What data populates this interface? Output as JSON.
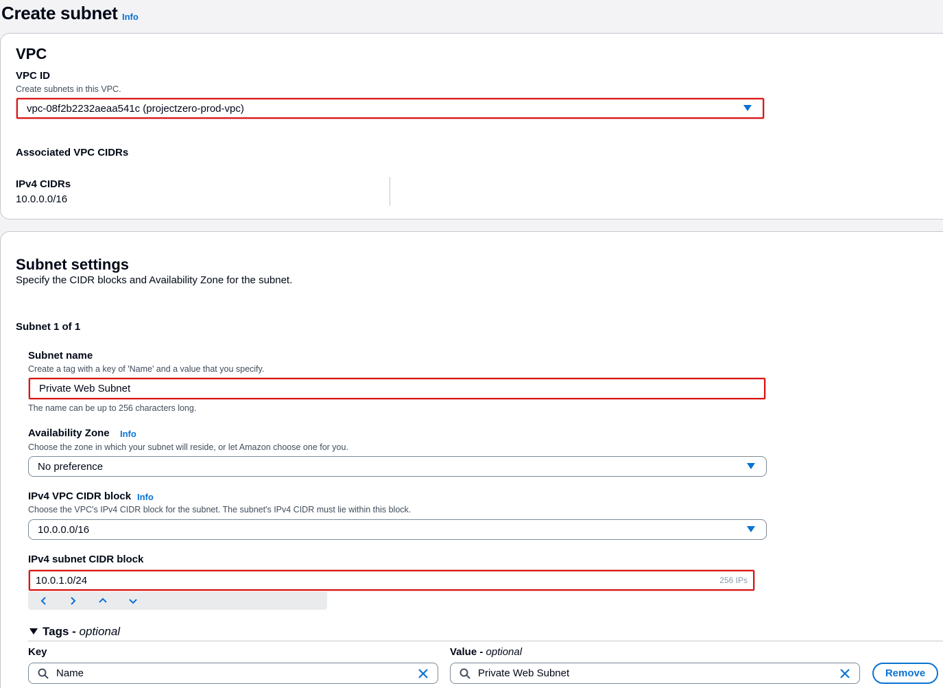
{
  "header": {
    "title": "Create subnet",
    "info": "Info"
  },
  "vpc": {
    "heading": "VPC",
    "vpc_id_label": "VPC ID",
    "vpc_id_desc": "Create subnets in this VPC.",
    "vpc_id_value": "vpc-08f2b2232aeaa541c (projectzero-prod-vpc)",
    "assoc_heading": "Associated VPC CIDRs",
    "ipv4_cidrs_label": "IPv4 CIDRs",
    "ipv4_cidrs_value": "10.0.0.0/16"
  },
  "subnet_settings": {
    "heading": "Subnet settings",
    "desc": "Specify the CIDR blocks and Availability Zone for the subnet.",
    "subnet_count": "Subnet 1 of 1",
    "name_label": "Subnet name",
    "name_desc": "Create a tag with a key of 'Name' and a value that you specify.",
    "name_value": "Private Web Subnet",
    "name_hint": "The name can be up to 256 characters long.",
    "az_label": "Availability Zone",
    "az_info": "Info",
    "az_desc": "Choose the zone in which your subnet will reside, or let Amazon choose one for you.",
    "az_value": "No preference",
    "vpc_cidr_label": "IPv4 VPC CIDR block",
    "vpc_cidr_info": "Info",
    "vpc_cidr_desc": "Choose the VPC's IPv4 CIDR block for the subnet. The subnet's IPv4 CIDR must lie within this block.",
    "vpc_cidr_value": "10.0.0.0/16",
    "subnet_cidr_label": "IPv4 subnet CIDR block",
    "subnet_cidr_value": "10.0.1.0/24",
    "subnet_cidr_ips": "256 IPs"
  },
  "tags": {
    "heading": "Tags - ",
    "heading_optional": "optional",
    "key_label": "Key",
    "value_label": "Value - ",
    "value_optional": "optional",
    "key_value": "Name",
    "value_value": "Private Web Subnet",
    "remove_label": "Remove"
  },
  "colors": {
    "accent": "#0972d3",
    "highlight": "#d91515"
  }
}
